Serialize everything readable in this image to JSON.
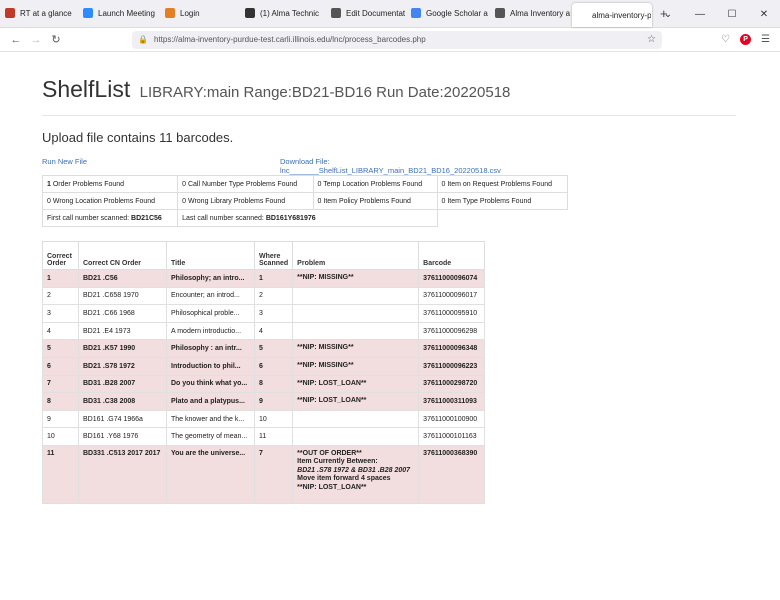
{
  "browser": {
    "tabs": [
      {
        "label": "RT at a glance",
        "color": "#c0392b"
      },
      {
        "label": "Launch Meeting",
        "color": "#2d8cff"
      },
      {
        "label": "Login",
        "color": "#e67e22"
      },
      {
        "label": "(1) Alma Technic",
        "color": "#333333"
      },
      {
        "label": "Edit Documentati",
        "color": "#555555"
      },
      {
        "label": "Google Scholar a",
        "color": "#4285f4"
      },
      {
        "label": "Alma Inventory a",
        "color": "#555555"
      },
      {
        "label": "alma-inventory-p",
        "color": "#ffffff",
        "active": true
      }
    ],
    "url": "https://alma-inventory-purdue-test.carli.illinois.edu/lnc/process_barcodes.php"
  },
  "header": {
    "title": "ShelfList",
    "subtitle": "LIBRARY:main Range:BD21-BD16 Run Date:20220518"
  },
  "upload_text": "Upload file contains 11 barcodes.",
  "links": {
    "run_new": "Run New File",
    "download_line1": "Download File:",
    "download_line2": "lnc_______ShelfList_LIBRARY_main_BD21_BD16_20220518.csv"
  },
  "stats": {
    "row1": [
      {
        "num": "1",
        "text": " Order Problems Found"
      },
      {
        "num": "",
        "text": "0 Call Number Type Problems Found"
      },
      {
        "num": "",
        "text": "0 Temp Location Problems Found"
      },
      {
        "num": "",
        "text": "0 Item on Request Problems Found"
      }
    ],
    "row2": [
      "0 Wrong Location Problems Found",
      "0 Wrong Library Problems Found",
      "0 Item Policy Problems Found",
      "0 Item Type Problems Found"
    ],
    "first_label": "First call number scanned: ",
    "first_value": "BD21C56",
    "last_label": "Last call number scanned: ",
    "last_value": "BD161Y681976"
  },
  "table": {
    "headers": [
      "Correct Order",
      "Correct CN Order",
      "Title",
      "Where Scanned",
      "Problem",
      "Barcode"
    ],
    "rows": [
      {
        "order": "1",
        "cn": "BD21 .C56",
        "title": "Philosophy; an intro...",
        "scanned": "1",
        "problem": [
          "**NIP: MISSING**"
        ],
        "barcode": "37611000096074",
        "error": true
      },
      {
        "order": "2",
        "cn": "BD21 .C658 1970",
        "title": "Encounter; an introd...",
        "scanned": "2",
        "problem": [],
        "barcode": "37611000096017",
        "error": false
      },
      {
        "order": "3",
        "cn": "BD21 .C66 1968",
        "title": "Philosophical proble...",
        "scanned": "3",
        "problem": [],
        "barcode": "37611000095910",
        "error": false
      },
      {
        "order": "4",
        "cn": "BD21 .E4 1973",
        "title": "A modern introductio...",
        "scanned": "4",
        "problem": [],
        "barcode": "37611000096298",
        "error": false
      },
      {
        "order": "5",
        "cn": "BD21 .K57 1990",
        "title": "Philosophy : an intr...",
        "scanned": "5",
        "problem": [
          "**NIP: MISSING**"
        ],
        "barcode": "37611000096348",
        "error": true
      },
      {
        "order": "6",
        "cn": "BD21 .S78 1972",
        "title": "Introduction to phil...",
        "scanned": "6",
        "problem": [
          "**NIP: MISSING**"
        ],
        "barcode": "37611000096223",
        "error": true
      },
      {
        "order": "7",
        "cn": "BD31 .B28 2007",
        "title": "Do you think what yo...",
        "scanned": "8",
        "problem": [
          "**NIP: LOST_LOAN**"
        ],
        "barcode": "37611000298720",
        "error": true
      },
      {
        "order": "8",
        "cn": "BD31 .C38 2008",
        "title": "Plato and a platypus...",
        "scanned": "9",
        "problem": [
          "**NIP: LOST_LOAN**"
        ],
        "barcode": "37611000311093",
        "error": true
      },
      {
        "order": "9",
        "cn": "BD161 .G74 1966a",
        "title": "The knower and the k...",
        "scanned": "10",
        "problem": [],
        "barcode": "37611000100900",
        "error": false
      },
      {
        "order": "10",
        "cn": "BD161 .Y68 1976",
        "title": "The geometry of mean...",
        "scanned": "11",
        "problem": [],
        "barcode": "37611000101163",
        "error": false
      },
      {
        "order": "11",
        "cn": "BD331 .C513 2017 2017",
        "title": "You are the universe...",
        "scanned": "7",
        "problem": [
          "**OUT OF ORDER**",
          "Item Currently Between:",
          "BD21 .S78 1972 & BD31 .B28 2007",
          "Move item forward 4 spaces",
          "**NIP: LOST_LOAN**"
        ],
        "barcode": "37611000368390",
        "error": true,
        "big": true
      }
    ]
  }
}
